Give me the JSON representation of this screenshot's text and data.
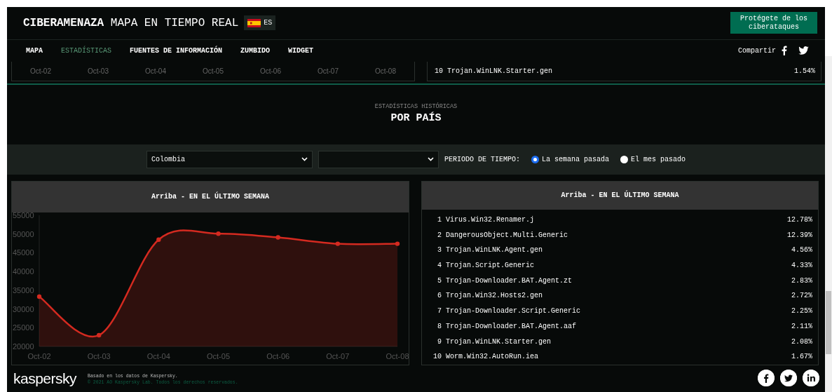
{
  "header": {
    "title_bold": "CIBERAMENAZA",
    "title_rest": "MAPA EN TIEMPO REAL",
    "language": "ES",
    "cta_button": "Protégete de los ciberataques"
  },
  "nav": {
    "items": [
      {
        "label": "MAPA",
        "selected": false
      },
      {
        "label": "ESTADÍSTICAS",
        "selected": true
      },
      {
        "label": "FUENTES DE INFORMACIÓN",
        "selected": false
      },
      {
        "label": "ZUMBIDO",
        "selected": false
      },
      {
        "label": "WIDGET",
        "selected": false
      }
    ],
    "share_label": "Compartir"
  },
  "previous_section": {
    "axis_labels": [
      "Oct-02",
      "Oct-03",
      "Oct-04",
      "Oct-05",
      "Oct-06",
      "Oct-07",
      "Oct-08"
    ],
    "last_row": {
      "rank": "10",
      "name": "Trojan.WinLNK.Starter.gen",
      "share": "1.54%"
    }
  },
  "section": {
    "subtitle": "ESTADÍSTICAS HISTÓRICAS",
    "title": "POR PAÍS"
  },
  "filters": {
    "country": "Colombia",
    "period_label": "PERIODO DE TIEMPO:",
    "periods": [
      {
        "label": "La semana pasada",
        "selected": true
      },
      {
        "label": "El mes pasado",
        "selected": false
      }
    ]
  },
  "chart_panel": {
    "title": "Arriba - EN EL ÚLTIMO SEMANA",
    "chart_data": {
      "type": "area",
      "categories": [
        "Oct-02",
        "Oct-03",
        "Oct-04",
        "Oct-05",
        "Oct-06",
        "Oct-07",
        "Oct-08"
      ],
      "series": [
        {
          "color": "#d42a20",
          "values": [
            33300,
            23000,
            48500,
            50100,
            49100,
            47400,
            47400
          ]
        }
      ],
      "ylim": [
        20000,
        55000
      ],
      "yticks": [
        20000,
        25000,
        30000,
        35000,
        40000,
        45000,
        50000,
        55000
      ]
    }
  },
  "top_list": {
    "title": "Arriba - EN EL ÚLTIMO SEMANA",
    "rows": [
      {
        "rank": "1",
        "name": "Virus.Win32.Renamer.j",
        "share": "12.78%"
      },
      {
        "rank": "2",
        "name": "DangerousObject.Multi.Generic",
        "share": "12.39%"
      },
      {
        "rank": "3",
        "name": "Trojan.WinLNK.Agent.gen",
        "share": "4.56%"
      },
      {
        "rank": "4",
        "name": "Trojan.Script.Generic",
        "share": "4.33%"
      },
      {
        "rank": "5",
        "name": "Trojan-Downloader.BAT.Agent.zt",
        "share": "2.83%"
      },
      {
        "rank": "6",
        "name": "Trojan.Win32.Hosts2.gen",
        "share": "2.72%"
      },
      {
        "rank": "7",
        "name": "Trojan-Downloader.Script.Generic",
        "share": "2.25%"
      },
      {
        "rank": "8",
        "name": "Trojan-Downloader.BAT.Agent.aaf",
        "share": "2.11%"
      },
      {
        "rank": "9",
        "name": "Trojan.WinLNK.Starter.gen",
        "share": "2.08%"
      },
      {
        "rank": "10",
        "name": "Worm.Win32.AutoRun.iea",
        "share": "1.67%"
      }
    ]
  },
  "footer": {
    "logo": "kaspersky",
    "source": "Basado en los datos de Kaspersky.",
    "copyright": "© 2021 AO Kaspersky Lab. Todos los derechos reservados."
  }
}
